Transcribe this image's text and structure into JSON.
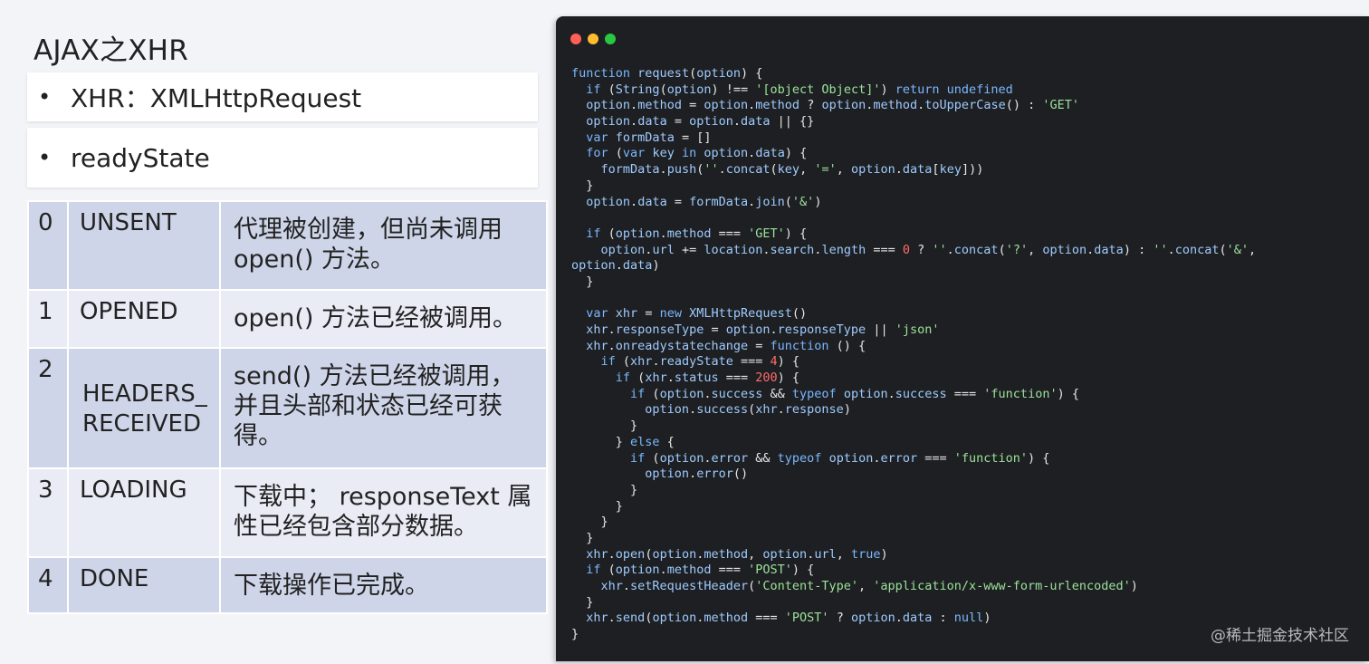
{
  "slide": {
    "title": "AJAX之XHR",
    "bullets": [
      {
        "marker": "•",
        "text": "XHR：XMLHttpRequest"
      },
      {
        "marker": "•",
        "text": "readyState"
      }
    ],
    "table": [
      {
        "num": "0",
        "name": "UNSENT",
        "desc": "代理被创建，但尚未调用 open() 方法。"
      },
      {
        "num": "1",
        "name": "OPENED",
        "desc": "open() 方法已经被调用。"
      },
      {
        "num": "2",
        "name": "HEADERS_ RECEIVED",
        "desc": "send() 方法已经被调用，并且头部和状态已经可获得。"
      },
      {
        "num": "3",
        "name": "LOADING",
        "desc": "下载中； responseText 属性已经包含部分数据。"
      },
      {
        "num": "4",
        "name": "DONE",
        "desc": "下载操作已完成。"
      }
    ]
  },
  "code_lines": [
    "function request(option) {",
    "  if (String(option) !== '[object Object]') return undefined",
    "  option.method = option.method ? option.method.toUpperCase() : 'GET'",
    "  option.data = option.data || {}",
    "  var formData = []",
    "  for (var key in option.data) {",
    "    formData.push(''.concat(key, '=', option.data[key]))",
    "  }",
    "  option.data = formData.join('&')",
    "",
    "  if (option.method === 'GET') {",
    "    option.url += location.search.length === 0 ? ''.concat('?', option.data) : ''.concat('&',",
    "option.data)",
    "  }",
    "",
    "  var xhr = new XMLHttpRequest()",
    "  xhr.responseType = option.responseType || 'json'",
    "  xhr.onreadystatechange = function () {",
    "    if (xhr.readyState === 4) {",
    "      if (xhr.status === 200) {",
    "        if (option.success && typeof option.success === 'function') {",
    "          option.success(xhr.response)",
    "        }",
    "      } else {",
    "        if (option.error && typeof option.error === 'function') {",
    "          option.error()",
    "        }",
    "      }",
    "    }",
    "  }",
    "  xhr.open(option.method, option.url, true)",
    "  if (option.method === 'POST') {",
    "    xhr.setRequestHeader('Content-Type', 'application/x-www-form-urlencoded')",
    "  }",
    "  xhr.send(option.method === 'POST' ? option.data : null)",
    "}"
  ],
  "watermark": "@稀土掘金技术社区",
  "colors": {
    "keyword": "#79b8ff",
    "string": "#9be39b",
    "number": "#ff6b6b",
    "code_bg": "#1e1f22",
    "table_dark": "#cfd5e9",
    "table_light": "#e9ebf5"
  }
}
